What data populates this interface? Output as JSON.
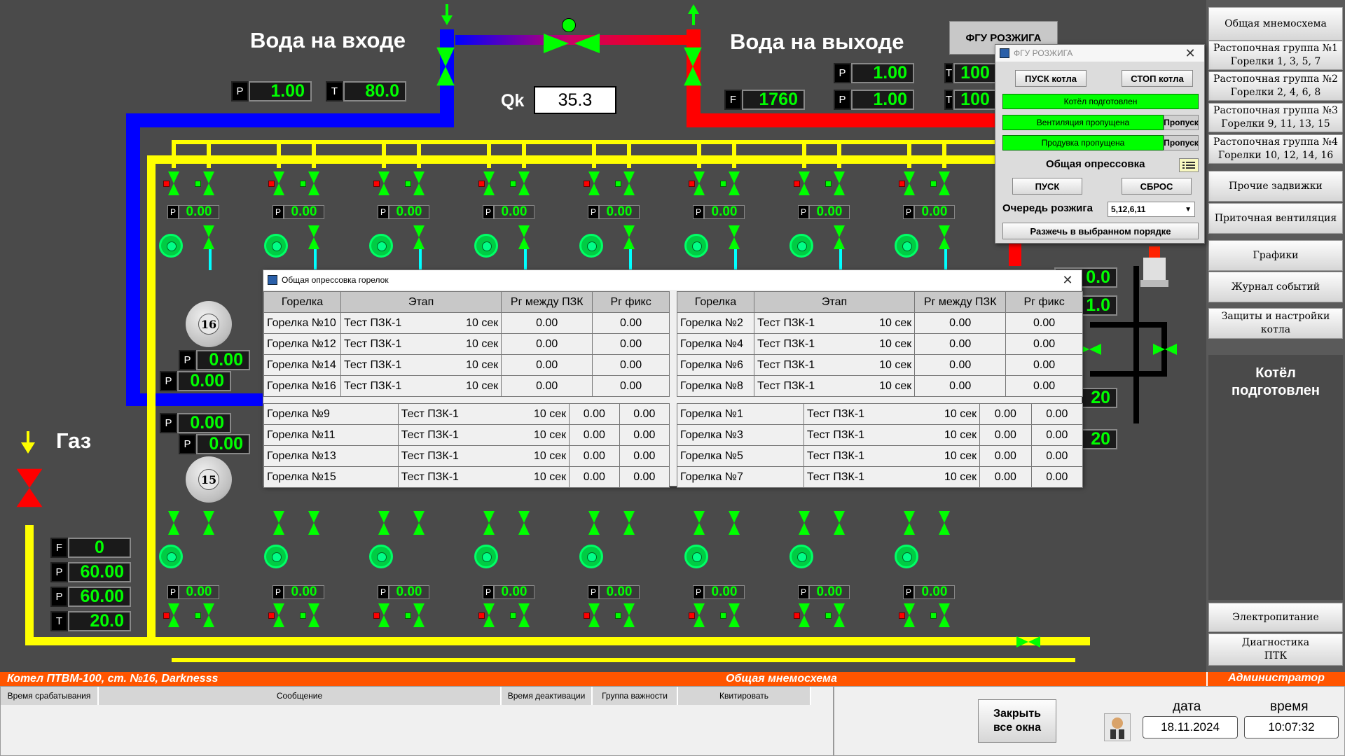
{
  "scheme": {
    "water_in_title": "Вода на входе",
    "water_out_title": "Вода на выходе",
    "gas_title": "Газ",
    "fgu_button": "ФГУ РОЗЖИГА",
    "qk_label": "Qk",
    "qk_value": "35.3",
    "water_in": {
      "p_tag": "P",
      "p": "1.00",
      "t_tag": "T",
      "t": "80.0"
    },
    "water_out": {
      "f_tag": "F",
      "f": "1760",
      "p1_tag": "P",
      "p1": "1.00",
      "p2_tag": "P",
      "p2": "1.00",
      "t1_tag": "T",
      "t1": "100",
      "t2_tag": "T",
      "t2": "100"
    },
    "gas": [
      {
        "tag": "F",
        "value": "0"
      },
      {
        "tag": "P",
        "value": "60.00"
      },
      {
        "tag": "P",
        "value": "60.00"
      },
      {
        "tag": "T",
        "value": "20.0"
      }
    ],
    "mid_readouts": [
      {
        "tag": "P",
        "value": "0.00"
      },
      {
        "tag": "P",
        "value": "0.00"
      },
      {
        "tag": "P",
        "value": "0.00"
      },
      {
        "tag": "P",
        "value": "0.00"
      }
    ],
    "burner_top_p": [
      "0.00",
      "0.00",
      "0.00",
      "0.00",
      "0.00",
      "0.00",
      "0.00",
      "0.00"
    ],
    "burner_bottom_p": [
      "0.00",
      "0.00",
      "0.00",
      "0.00",
      "0.00",
      "0.00",
      "0.00",
      "0.00"
    ],
    "p_tag": "P",
    "vessel_16": "16",
    "vessel_15": "15",
    "right_partial": [
      "0.0",
      "1.0",
      "20",
      "20"
    ]
  },
  "menu": {
    "items": [
      "Общая мнемосхема",
      "Растопочная группа №1\nГорелки 1, 3, 5, 7",
      "Растопочная группа №2\nГорелки 2, 4, 6, 8",
      "Растопочная группа №3\nГорелки 9, 11, 13, 15",
      "Растопочная группа №4\nГорелки 10, 12, 14, 16",
      "Прочие задвижки",
      "Приточная вентиляция",
      "Графики",
      "Журнал событий",
      "Защиты и настройки котла",
      "Электропитание",
      "Диагностика\nПТК"
    ],
    "status": "Котёл\nподготовлен"
  },
  "statusbar": {
    "left": "Котел ПТВМ-100, ст. №16, Darknesss",
    "center": "Общая мнемосхема",
    "right": "Администратор"
  },
  "alarms": {
    "columns": [
      "Время срабатывания",
      "Сообщение",
      "Время деактивации",
      "Группа важности",
      "Квитировать"
    ]
  },
  "bottom": {
    "close_label": "Закрыть\nвсе окна",
    "date_label": "дата",
    "time_label": "время",
    "date": "18.11.2024",
    "time": "10:07:32"
  },
  "fgu_window": {
    "title": "ФГУ РОЗЖИГА",
    "start_boiler": "ПУСК котла",
    "stop_boiler": "СТОП котла",
    "boiler_ready": "Котёл подготовлен",
    "vent_passed": "Вентиляция пропущена",
    "purge_passed": "Продувка пропущена",
    "skip": "Пропуск",
    "pressure_test_title": "Общая опрессовка",
    "start": "ПУСК",
    "reset": "СБРОС",
    "order_label": "Очередь розжига",
    "order_value": "5,12,6,11",
    "ignite_button": "Разжечь в выбранном порядке"
  },
  "test_window": {
    "title": "Общая опрессовка горелок",
    "headers": [
      "Горелка",
      "Этап",
      "Рг между ПЗК",
      "Рг фикс"
    ],
    "left_top": [
      [
        "Горелка №10",
        "Тест ПЗК-1",
        "10 сек",
        "0.00",
        "0.00"
      ],
      [
        "Горелка №12",
        "Тест ПЗК-1",
        "10 сек",
        "0.00",
        "0.00"
      ],
      [
        "Горелка №14",
        "Тест ПЗК-1",
        "10 сек",
        "0.00",
        "0.00"
      ],
      [
        "Горелка №16",
        "Тест ПЗК-1",
        "10 сек",
        "0.00",
        "0.00"
      ]
    ],
    "left_bottom": [
      [
        "Горелка №9",
        "Тест ПЗК-1",
        "10 сек",
        "0.00",
        "0.00"
      ],
      [
        "Горелка №11",
        "Тест ПЗК-1",
        "10 сек",
        "0.00",
        "0.00"
      ],
      [
        "Горелка №13",
        "Тест ПЗК-1",
        "10 сек",
        "0.00",
        "0.00"
      ],
      [
        "Горелка №15",
        "Тест ПЗК-1",
        "10 сек",
        "0.00",
        "0.00"
      ]
    ],
    "right_top": [
      [
        "Горелка №2",
        "Тест ПЗК-1",
        "10 сек",
        "0.00",
        "0.00"
      ],
      [
        "Горелка №4",
        "Тест ПЗК-1",
        "10 сек",
        "0.00",
        "0.00"
      ],
      [
        "Горелка №6",
        "Тест ПЗК-1",
        "10 сек",
        "0.00",
        "0.00"
      ],
      [
        "Горелка №8",
        "Тест ПЗК-1",
        "10 сек",
        "0.00",
        "0.00"
      ]
    ],
    "right_bottom": [
      [
        "Горелка №1",
        "Тест ПЗК-1",
        "10 сек",
        "0.00",
        "0.00"
      ],
      [
        "Горелка №3",
        "Тест ПЗК-1",
        "10 сек",
        "0.00",
        "0.00"
      ],
      [
        "Горелка №5",
        "Тест ПЗК-1",
        "10 сек",
        "0.00",
        "0.00"
      ],
      [
        "Горелка №7",
        "Тест ПЗК-1",
        "10 сек",
        "0.00",
        "0.00"
      ]
    ]
  }
}
